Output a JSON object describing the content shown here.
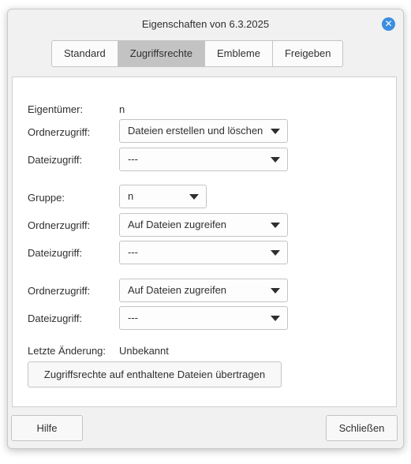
{
  "window": {
    "title": "Eigenschaften von 6.3.2025"
  },
  "tabs": [
    {
      "label": "Standard",
      "active": false
    },
    {
      "label": "Zugriffsrechte",
      "active": true
    },
    {
      "label": "Embleme",
      "active": false
    },
    {
      "label": "Freigeben",
      "active": false
    }
  ],
  "owner": {
    "label": "Eigentümer:",
    "value": "n",
    "folder_access_label": "Ordnerzugriff:",
    "folder_access_value": "Dateien erstellen und löschen",
    "file_access_label": "Dateizugriff:",
    "file_access_value": "---"
  },
  "group": {
    "label": "Gruppe:",
    "value": "n",
    "folder_access_label": "Ordnerzugriff:",
    "folder_access_value": "Auf Dateien zugreifen",
    "file_access_label": "Dateizugriff:",
    "file_access_value": "---"
  },
  "others": {
    "folder_access_label": "Ordnerzugriff:",
    "folder_access_value": "Auf Dateien zugreifen",
    "file_access_label": "Dateizugriff:",
    "file_access_value": "---"
  },
  "last_change": {
    "label": "Letzte Änderung:",
    "value": "Unbekannt"
  },
  "apply_button": "Zugriffsrechte auf enthaltene Dateien übertragen",
  "footer": {
    "help": "Hilfe",
    "close": "Schließen"
  },
  "colors": {
    "accent": "#3b8ee0",
    "active_tab": "#c3c3c3",
    "window_bg": "#f1f1f1"
  }
}
